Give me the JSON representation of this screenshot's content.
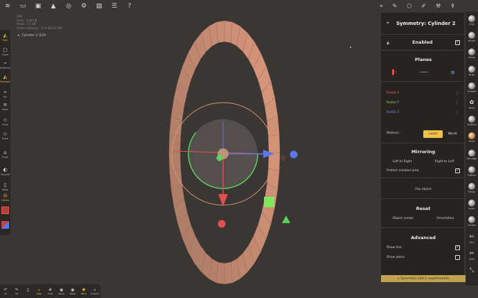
{
  "topbar": {
    "icons": [
      "menu-icon",
      "folder-icon",
      "camera-icon",
      "scene-icon",
      "shading-icon",
      "settings-icon",
      "picture-icon",
      "list-icon",
      "help-icon",
      "pen-icon",
      "wireframe-icon",
      "eyedropper-icon"
    ]
  },
  "stats": {
    "l1": "SUB",
    "l2": "Verts : 1.44 kB",
    "l3": "Faces : 1.1 kB",
    "l4": "Vertex memory : 15.4 kB (21 kB)"
  },
  "object_label": "Cylinder 2 (1/0)",
  "left_tools": [
    {
      "icon": "◭",
      "label": "Sym",
      "active": true
    },
    {
      "icon": "▢",
      "label": "Clone"
    },
    {
      "icon": "⌁",
      "label": "Instance"
    },
    {
      "icon": "◭",
      "label": "Dockset",
      "active": true
    },
    {
      "icon": "⌖",
      "label": "Pin"
    },
    {
      "icon": "≡",
      "label": "Align"
    },
    {
      "icon": "◇",
      "label": "Snap"
    },
    {
      "icon": "◇",
      "label": "Snap"
    },
    {
      "icon": "⌂",
      "label": "Pivot"
    },
    {
      "icon": "◐",
      "label": "Smooth"
    },
    {
      "icon": "▯",
      "label": "Mask"
    },
    {
      "icon": "◎",
      "label": "Gizmo",
      "active": true
    }
  ],
  "bottom_tools": [
    {
      "icon": "↶",
      "label": "Un"
    },
    {
      "icon": "↷",
      "label": "Re"
    },
    {
      "icon": "▯",
      "label": "."
    },
    {
      "icon": "⌕",
      "label": "Solo",
      "active": true
    },
    {
      "icon": "#",
      "label": "Grid"
    },
    {
      "icon": "◉",
      "label": "Mask"
    },
    {
      "icon": "◉",
      "label": "Voxel"
    },
    {
      "icon": "✺",
      "label": "Wire",
      "active": true
    },
    {
      "icon": "⌕",
      "label": "Inspect"
    }
  ],
  "panel": {
    "title": "Symmetry:  Cylinder 2",
    "enabled_label": "Enabled",
    "enabled_checked": "✓",
    "planes_title": "Planes",
    "plane_x": "X",
    "radial": [
      {
        "label": "Radial X",
        "color": "#e86a5a"
      },
      {
        "label": "Radial Y",
        "color": "#8ee05a"
      },
      {
        "label": "Radial Z",
        "color": "#6b8cf0"
      }
    ],
    "method_label": "Method :",
    "method_options": [
      "Local",
      "World"
    ],
    "method_selected": "Local",
    "mirroring_title": "Mirroring",
    "left_to_right": "Left to Right",
    "right_to_left": "Right to Left",
    "protect_masked": "Protect masked area",
    "protect_checked": "✓",
    "flip_object": "Flip object",
    "reset_title": "Reset",
    "object_center": "Object center",
    "orientation": "Orientation",
    "advanced_title": "Advanced",
    "show_line": "Show line",
    "show_line_checked": "✓",
    "show_plane": "Show plane",
    "warning": "⚠ Symmetry edit is experimental."
  },
  "right_brushes": [
    {
      "label": "Clay",
      "kind": "ball"
    },
    {
      "label": "Brush",
      "kind": "ball"
    },
    {
      "label": "Move",
      "kind": "ball"
    },
    {
      "label": "Drag",
      "kind": "ball"
    },
    {
      "label": "Smooth",
      "kind": "ball"
    },
    {
      "label": "Mask",
      "kind": "glyph",
      "glyph": "✿"
    },
    {
      "label": "SelRect",
      "kind": "ball"
    },
    {
      "label": "Paint",
      "kind": "orange"
    },
    {
      "label": "Smudge",
      "kind": "ball"
    },
    {
      "label": "Flatten",
      "kind": "ball"
    },
    {
      "label": "Planar",
      "kind": "ball"
    },
    {
      "label": "Layer",
      "kind": "ball"
    },
    {
      "label": "Crease",
      "kind": "ball"
    },
    {
      "label": "Trim",
      "kind": "glyph",
      "glyph": "✄"
    },
    {
      "label": "Split",
      "kind": "glyph",
      "glyph": "✂"
    },
    {
      "label": "",
      "kind": "glyph",
      "glyph": "⤡"
    }
  ],
  "colors": {
    "ring": "#d49479",
    "axis_x": "#e05050",
    "axis_y": "#5ad060",
    "axis_z": "#5a78e8",
    "accent": "#f0c04b"
  }
}
